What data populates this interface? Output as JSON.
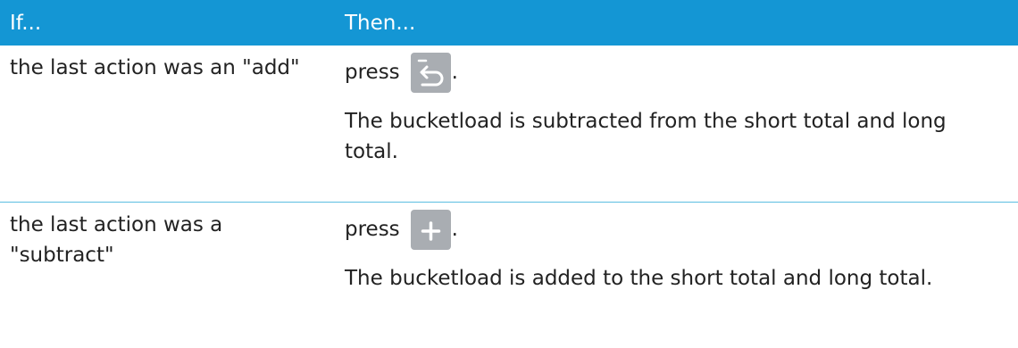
{
  "header": {
    "if_label": "If...",
    "then_label": "Then..."
  },
  "rows": [
    {
      "condition": "the last action was an \"add\"",
      "press_word": "press",
      "key_icon": "undo-subtract-icon",
      "period": ".",
      "result": "The bucketload is subtracted from the short total and long total."
    },
    {
      "condition": "the last action was a \"subtract\"",
      "press_word": "press",
      "key_icon": "plus-icon",
      "period": ".",
      "result": "The bucketload is added to the short total and long total."
    }
  ],
  "colors": {
    "header_bg": "#1496d4",
    "header_text": "#ffffff",
    "key_bg": "#a9adb2",
    "divider": "#5bbde0"
  }
}
